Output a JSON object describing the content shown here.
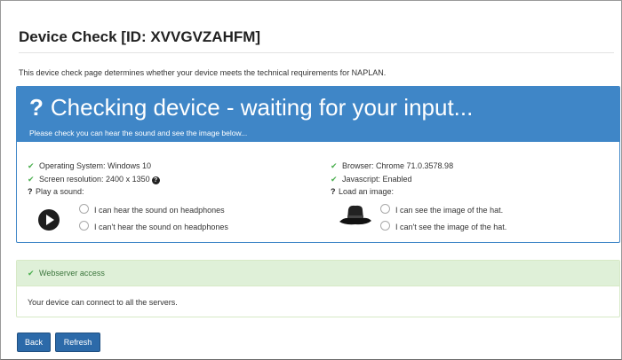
{
  "page": {
    "title": "Device Check [ID: XVVGVZAHFM]",
    "intro": "This device check page determines whether your device meets the technical requirements for NAPLAN."
  },
  "status_panel": {
    "heading": "Checking device - waiting for your input...",
    "subheading": "Please check you can hear the sound and see the image below...",
    "accent_color": "#3f86c7",
    "left_checks": [
      {
        "label": "Operating System: Windows 10",
        "status": "ok"
      },
      {
        "label": "Screen resolution: 2400 x 1350",
        "status": "ok",
        "info_icon": "question-circle-icon"
      }
    ],
    "right_checks": [
      {
        "label": "Browser: Chrome 71.0.3578.98",
        "status": "ok"
      },
      {
        "label": "Javascript: Enabled",
        "status": "ok"
      }
    ],
    "sound": {
      "prompt": "Play a sound:",
      "option_yes": "I can hear the sound on headphones",
      "option_no": "I can't hear the sound on headphones"
    },
    "image": {
      "prompt": "Load an image:",
      "option_yes": "I can see the image of the hat.",
      "option_no": "I can't see the image of the hat."
    }
  },
  "server_panel": {
    "heading": "Webserver access",
    "body": "Your device can connect to all the servers.",
    "accent_color": "#dff0d8"
  },
  "buttons": {
    "back": "Back",
    "refresh": "Refresh"
  }
}
